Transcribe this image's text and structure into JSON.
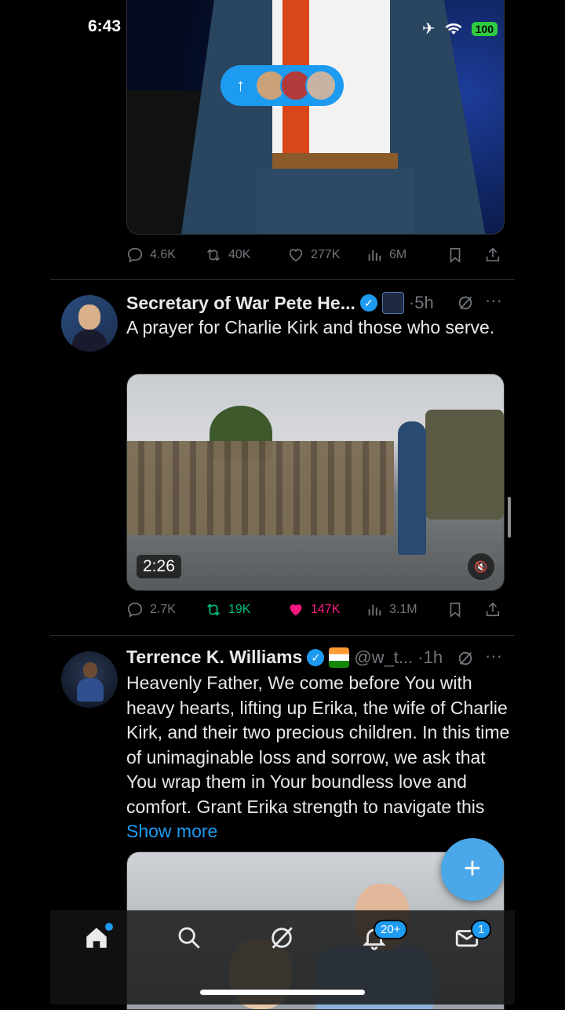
{
  "status": {
    "time": "6:43",
    "battery": "100"
  },
  "new_posts_pill": {
    "arrow": "↑"
  },
  "tweets": [
    {
      "actions": {
        "replies": "4.6K",
        "reposts": "40K",
        "likes": "277K",
        "views": "6M"
      }
    },
    {
      "name": "Secretary of War Pete He...",
      "time": "5h",
      "text": "A prayer for Charlie Kirk and those who serve.",
      "video_duration": "2:26",
      "actions": {
        "replies": "2.7K",
        "reposts": "19K",
        "likes": "147K",
        "views": "3.1M"
      }
    },
    {
      "name": "Terrence K. Williams",
      "handle": "@w_t...",
      "time": "1h",
      "text": "Heavenly Father, We come before You with heavy hearts, lifting up Erika, the wife of Charlie Kirk, and their two precious children. In this time of unimaginable loss and sorrow, we ask that You wrap them in Your boundless love and comfort. Grant Erika strength to navigate this",
      "show_more": "Show more"
    }
  ],
  "fab": {
    "icon": "+"
  },
  "nav": {
    "notifications_badge": "20+",
    "messages_badge": "1"
  },
  "colors": {
    "accent": "#1d9bf0",
    "like": "#f91880",
    "repost": "#00ba7c",
    "muted": "#71767b"
  }
}
